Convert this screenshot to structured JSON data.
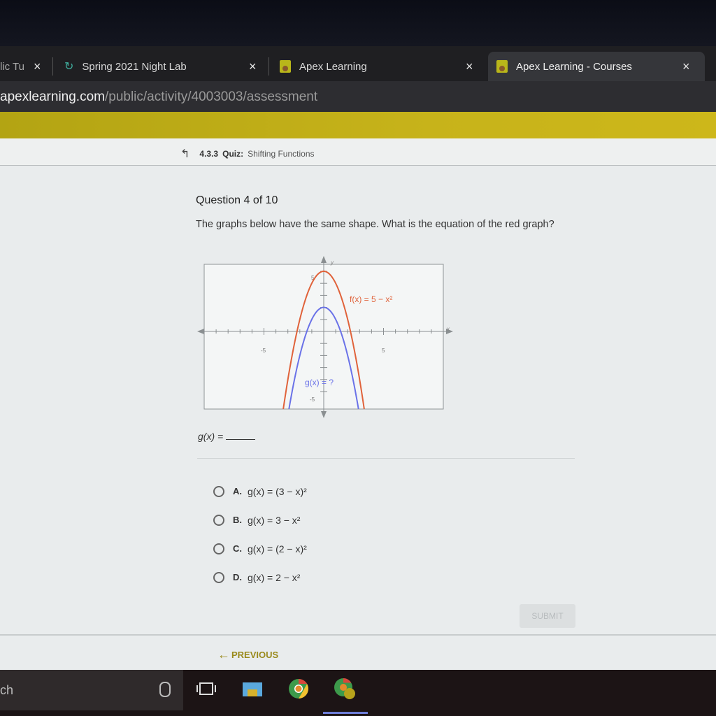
{
  "browser": {
    "tabs": [
      {
        "label": "lic Tu",
        "active": false
      },
      {
        "label": "Spring 2021 Night Lab",
        "active": false
      },
      {
        "label": "Apex Learning",
        "active": false
      },
      {
        "label": "Apex Learning - Courses",
        "active": true
      }
    ],
    "close_glyph": "×",
    "url_host": "apexlearning.com",
    "url_path": "/public/activity/4003003/assessment"
  },
  "breadcrumb": {
    "number": "4.3.3",
    "type": "Quiz:",
    "title": "Shifting Functions"
  },
  "question": {
    "counter": "Question 4 of 10",
    "prompt": "The graphs below have the same shape. What is the equation of the red graph?",
    "answer_prefix": "g(x) ="
  },
  "graph": {
    "x_label": "x",
    "y_label": "y",
    "tick_labels": {
      "x_neg": "-5",
      "x_pos": "5",
      "y_pos": "5",
      "y_neg": "-5"
    },
    "f_label": "f(x) = 5 − x²",
    "g_label": "g(x) = ?",
    "colors": {
      "f": "#e0623a",
      "g": "#6a72e8"
    },
    "f_vertex_y": 5,
    "g_vertex_y": 2,
    "x_range": [
      -10,
      10
    ],
    "y_range": [
      -6,
      6
    ]
  },
  "options": [
    {
      "letter": "A.",
      "text": "g(x) = (3 − x)²"
    },
    {
      "letter": "B.",
      "text": "g(x) = 3 − x²"
    },
    {
      "letter": "C.",
      "text": "g(x) = (2 − x)²"
    },
    {
      "letter": "D.",
      "text": "g(x) = 2 − x²"
    }
  ],
  "buttons": {
    "submit": "SUBMIT",
    "previous": "PREVIOUS"
  },
  "taskbar": {
    "search_text": "ch"
  }
}
